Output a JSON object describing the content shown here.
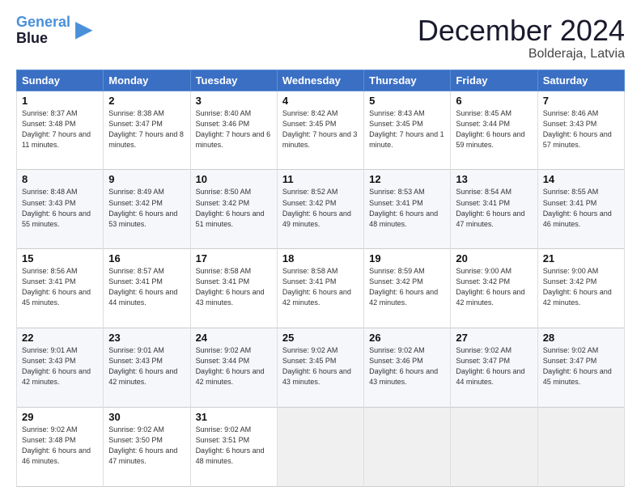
{
  "header": {
    "logo_line1": "General",
    "logo_line2": "Blue",
    "month": "December 2024",
    "location": "Bolderaja, Latvia"
  },
  "days_of_week": [
    "Sunday",
    "Monday",
    "Tuesday",
    "Wednesday",
    "Thursday",
    "Friday",
    "Saturday"
  ],
  "weeks": [
    [
      {
        "day": "1",
        "sunrise": "8:37 AM",
        "sunset": "3:48 PM",
        "daylight": "7 hours and 11 minutes."
      },
      {
        "day": "2",
        "sunrise": "8:38 AM",
        "sunset": "3:47 PM",
        "daylight": "7 hours and 8 minutes."
      },
      {
        "day": "3",
        "sunrise": "8:40 AM",
        "sunset": "3:46 PM",
        "daylight": "7 hours and 6 minutes."
      },
      {
        "day": "4",
        "sunrise": "8:42 AM",
        "sunset": "3:45 PM",
        "daylight": "7 hours and 3 minutes."
      },
      {
        "day": "5",
        "sunrise": "8:43 AM",
        "sunset": "3:45 PM",
        "daylight": "7 hours and 1 minute."
      },
      {
        "day": "6",
        "sunrise": "8:45 AM",
        "sunset": "3:44 PM",
        "daylight": "6 hours and 59 minutes."
      },
      {
        "day": "7",
        "sunrise": "8:46 AM",
        "sunset": "3:43 PM",
        "daylight": "6 hours and 57 minutes."
      }
    ],
    [
      {
        "day": "8",
        "sunrise": "8:48 AM",
        "sunset": "3:43 PM",
        "daylight": "6 hours and 55 minutes."
      },
      {
        "day": "9",
        "sunrise": "8:49 AM",
        "sunset": "3:42 PM",
        "daylight": "6 hours and 53 minutes."
      },
      {
        "day": "10",
        "sunrise": "8:50 AM",
        "sunset": "3:42 PM",
        "daylight": "6 hours and 51 minutes."
      },
      {
        "day": "11",
        "sunrise": "8:52 AM",
        "sunset": "3:42 PM",
        "daylight": "6 hours and 49 minutes."
      },
      {
        "day": "12",
        "sunrise": "8:53 AM",
        "sunset": "3:41 PM",
        "daylight": "6 hours and 48 minutes."
      },
      {
        "day": "13",
        "sunrise": "8:54 AM",
        "sunset": "3:41 PM",
        "daylight": "6 hours and 47 minutes."
      },
      {
        "day": "14",
        "sunrise": "8:55 AM",
        "sunset": "3:41 PM",
        "daylight": "6 hours and 46 minutes."
      }
    ],
    [
      {
        "day": "15",
        "sunrise": "8:56 AM",
        "sunset": "3:41 PM",
        "daylight": "6 hours and 45 minutes."
      },
      {
        "day": "16",
        "sunrise": "8:57 AM",
        "sunset": "3:41 PM",
        "daylight": "6 hours and 44 minutes."
      },
      {
        "day": "17",
        "sunrise": "8:58 AM",
        "sunset": "3:41 PM",
        "daylight": "6 hours and 43 minutes."
      },
      {
        "day": "18",
        "sunrise": "8:58 AM",
        "sunset": "3:41 PM",
        "daylight": "6 hours and 42 minutes."
      },
      {
        "day": "19",
        "sunrise": "8:59 AM",
        "sunset": "3:42 PM",
        "daylight": "6 hours and 42 minutes."
      },
      {
        "day": "20",
        "sunrise": "9:00 AM",
        "sunset": "3:42 PM",
        "daylight": "6 hours and 42 minutes."
      },
      {
        "day": "21",
        "sunrise": "9:00 AM",
        "sunset": "3:42 PM",
        "daylight": "6 hours and 42 minutes."
      }
    ],
    [
      {
        "day": "22",
        "sunrise": "9:01 AM",
        "sunset": "3:43 PM",
        "daylight": "6 hours and 42 minutes."
      },
      {
        "day": "23",
        "sunrise": "9:01 AM",
        "sunset": "3:43 PM",
        "daylight": "6 hours and 42 minutes."
      },
      {
        "day": "24",
        "sunrise": "9:02 AM",
        "sunset": "3:44 PM",
        "daylight": "6 hours and 42 minutes."
      },
      {
        "day": "25",
        "sunrise": "9:02 AM",
        "sunset": "3:45 PM",
        "daylight": "6 hours and 43 minutes."
      },
      {
        "day": "26",
        "sunrise": "9:02 AM",
        "sunset": "3:46 PM",
        "daylight": "6 hours and 43 minutes."
      },
      {
        "day": "27",
        "sunrise": "9:02 AM",
        "sunset": "3:47 PM",
        "daylight": "6 hours and 44 minutes."
      },
      {
        "day": "28",
        "sunrise": "9:02 AM",
        "sunset": "3:47 PM",
        "daylight": "6 hours and 45 minutes."
      }
    ],
    [
      {
        "day": "29",
        "sunrise": "9:02 AM",
        "sunset": "3:48 PM",
        "daylight": "6 hours and 46 minutes."
      },
      {
        "day": "30",
        "sunrise": "9:02 AM",
        "sunset": "3:50 PM",
        "daylight": "6 hours and 47 minutes."
      },
      {
        "day": "31",
        "sunrise": "9:02 AM",
        "sunset": "3:51 PM",
        "daylight": "6 hours and 48 minutes."
      },
      null,
      null,
      null,
      null
    ]
  ]
}
